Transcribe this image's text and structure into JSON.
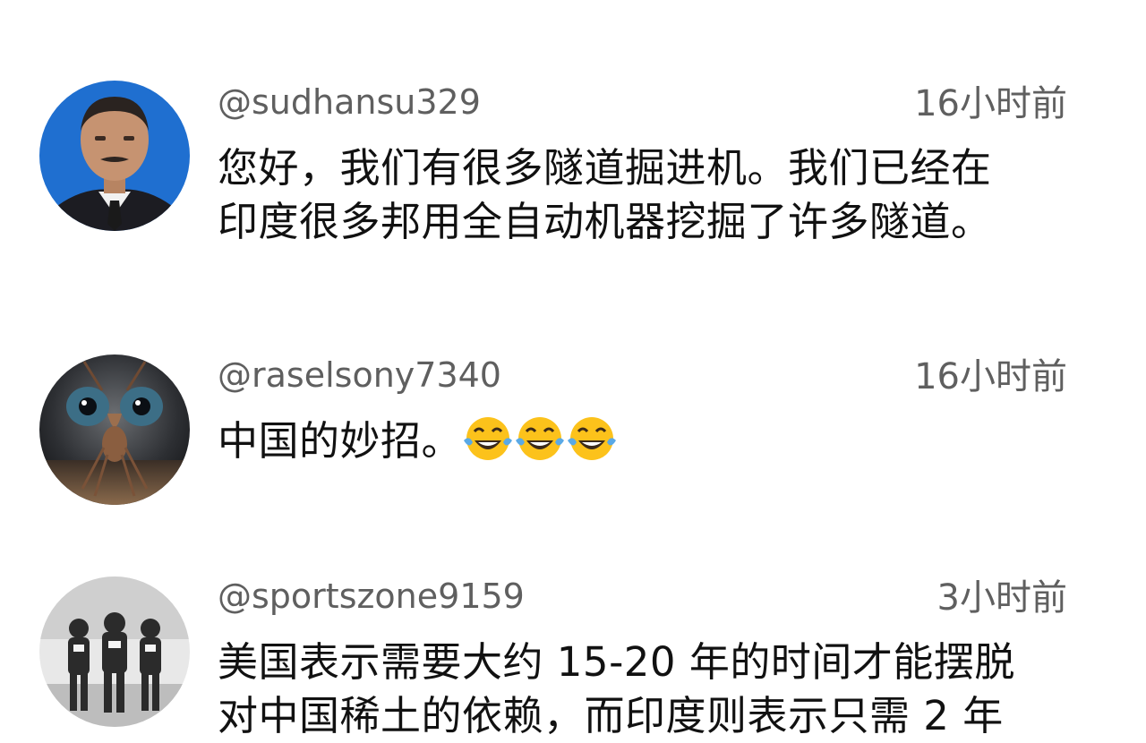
{
  "comments": [
    {
      "handle": "@sudhansu329",
      "time": "16小时前",
      "lines": [
        "您好，我们有很多隧道掘进机。我们已经在",
        "印度很多邦用全自动机器挖掘了许多隧道。"
      ]
    },
    {
      "handle": "@raselsony7340",
      "time": "16小时前",
      "lines": [
        "中国的妙招。"
      ],
      "emojis": [
        "face-with-tears-of-joy",
        "face-with-tears-of-joy",
        "face-with-tears-of-joy"
      ]
    },
    {
      "handle": "@sportszone9159",
      "time": "3小时前",
      "lines": [
        "美国表示需要大约 15-20 年的时间才能摆脱",
        "对中国稀土的依赖，而印度则表示只需 2 年"
      ]
    }
  ]
}
